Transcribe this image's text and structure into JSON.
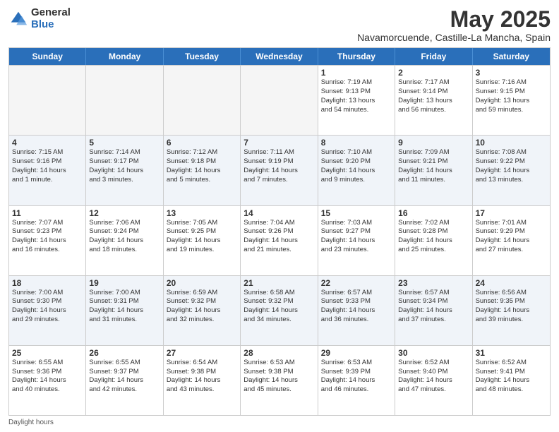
{
  "logo": {
    "general": "General",
    "blue": "Blue"
  },
  "title": "May 2025",
  "subtitle": "Navamorcuende, Castille-La Mancha, Spain",
  "days_of_week": [
    "Sunday",
    "Monday",
    "Tuesday",
    "Wednesday",
    "Thursday",
    "Friday",
    "Saturday"
  ],
  "weeks": [
    [
      {
        "day": "",
        "info": ""
      },
      {
        "day": "",
        "info": ""
      },
      {
        "day": "",
        "info": ""
      },
      {
        "day": "",
        "info": ""
      },
      {
        "day": "1",
        "info": "Sunrise: 7:19 AM\nSunset: 9:13 PM\nDaylight: 13 hours\nand 54 minutes."
      },
      {
        "day": "2",
        "info": "Sunrise: 7:17 AM\nSunset: 9:14 PM\nDaylight: 13 hours\nand 56 minutes."
      },
      {
        "day": "3",
        "info": "Sunrise: 7:16 AM\nSunset: 9:15 PM\nDaylight: 13 hours\nand 59 minutes."
      }
    ],
    [
      {
        "day": "4",
        "info": "Sunrise: 7:15 AM\nSunset: 9:16 PM\nDaylight: 14 hours\nand 1 minute."
      },
      {
        "day": "5",
        "info": "Sunrise: 7:14 AM\nSunset: 9:17 PM\nDaylight: 14 hours\nand 3 minutes."
      },
      {
        "day": "6",
        "info": "Sunrise: 7:12 AM\nSunset: 9:18 PM\nDaylight: 14 hours\nand 5 minutes."
      },
      {
        "day": "7",
        "info": "Sunrise: 7:11 AM\nSunset: 9:19 PM\nDaylight: 14 hours\nand 7 minutes."
      },
      {
        "day": "8",
        "info": "Sunrise: 7:10 AM\nSunset: 9:20 PM\nDaylight: 14 hours\nand 9 minutes."
      },
      {
        "day": "9",
        "info": "Sunrise: 7:09 AM\nSunset: 9:21 PM\nDaylight: 14 hours\nand 11 minutes."
      },
      {
        "day": "10",
        "info": "Sunrise: 7:08 AM\nSunset: 9:22 PM\nDaylight: 14 hours\nand 13 minutes."
      }
    ],
    [
      {
        "day": "11",
        "info": "Sunrise: 7:07 AM\nSunset: 9:23 PM\nDaylight: 14 hours\nand 16 minutes."
      },
      {
        "day": "12",
        "info": "Sunrise: 7:06 AM\nSunset: 9:24 PM\nDaylight: 14 hours\nand 18 minutes."
      },
      {
        "day": "13",
        "info": "Sunrise: 7:05 AM\nSunset: 9:25 PM\nDaylight: 14 hours\nand 19 minutes."
      },
      {
        "day": "14",
        "info": "Sunrise: 7:04 AM\nSunset: 9:26 PM\nDaylight: 14 hours\nand 21 minutes."
      },
      {
        "day": "15",
        "info": "Sunrise: 7:03 AM\nSunset: 9:27 PM\nDaylight: 14 hours\nand 23 minutes."
      },
      {
        "day": "16",
        "info": "Sunrise: 7:02 AM\nSunset: 9:28 PM\nDaylight: 14 hours\nand 25 minutes."
      },
      {
        "day": "17",
        "info": "Sunrise: 7:01 AM\nSunset: 9:29 PM\nDaylight: 14 hours\nand 27 minutes."
      }
    ],
    [
      {
        "day": "18",
        "info": "Sunrise: 7:00 AM\nSunset: 9:30 PM\nDaylight: 14 hours\nand 29 minutes."
      },
      {
        "day": "19",
        "info": "Sunrise: 7:00 AM\nSunset: 9:31 PM\nDaylight: 14 hours\nand 31 minutes."
      },
      {
        "day": "20",
        "info": "Sunrise: 6:59 AM\nSunset: 9:32 PM\nDaylight: 14 hours\nand 32 minutes."
      },
      {
        "day": "21",
        "info": "Sunrise: 6:58 AM\nSunset: 9:32 PM\nDaylight: 14 hours\nand 34 minutes."
      },
      {
        "day": "22",
        "info": "Sunrise: 6:57 AM\nSunset: 9:33 PM\nDaylight: 14 hours\nand 36 minutes."
      },
      {
        "day": "23",
        "info": "Sunrise: 6:57 AM\nSunset: 9:34 PM\nDaylight: 14 hours\nand 37 minutes."
      },
      {
        "day": "24",
        "info": "Sunrise: 6:56 AM\nSunset: 9:35 PM\nDaylight: 14 hours\nand 39 minutes."
      }
    ],
    [
      {
        "day": "25",
        "info": "Sunrise: 6:55 AM\nSunset: 9:36 PM\nDaylight: 14 hours\nand 40 minutes."
      },
      {
        "day": "26",
        "info": "Sunrise: 6:55 AM\nSunset: 9:37 PM\nDaylight: 14 hours\nand 42 minutes."
      },
      {
        "day": "27",
        "info": "Sunrise: 6:54 AM\nSunset: 9:38 PM\nDaylight: 14 hours\nand 43 minutes."
      },
      {
        "day": "28",
        "info": "Sunrise: 6:53 AM\nSunset: 9:38 PM\nDaylight: 14 hours\nand 45 minutes."
      },
      {
        "day": "29",
        "info": "Sunrise: 6:53 AM\nSunset: 9:39 PM\nDaylight: 14 hours\nand 46 minutes."
      },
      {
        "day": "30",
        "info": "Sunrise: 6:52 AM\nSunset: 9:40 PM\nDaylight: 14 hours\nand 47 minutes."
      },
      {
        "day": "31",
        "info": "Sunrise: 6:52 AM\nSunset: 9:41 PM\nDaylight: 14 hours\nand 48 minutes."
      }
    ]
  ],
  "footer": "Daylight hours",
  "colors": {
    "header_bg": "#2a6fba",
    "alt_row": "#f0f4f9"
  }
}
